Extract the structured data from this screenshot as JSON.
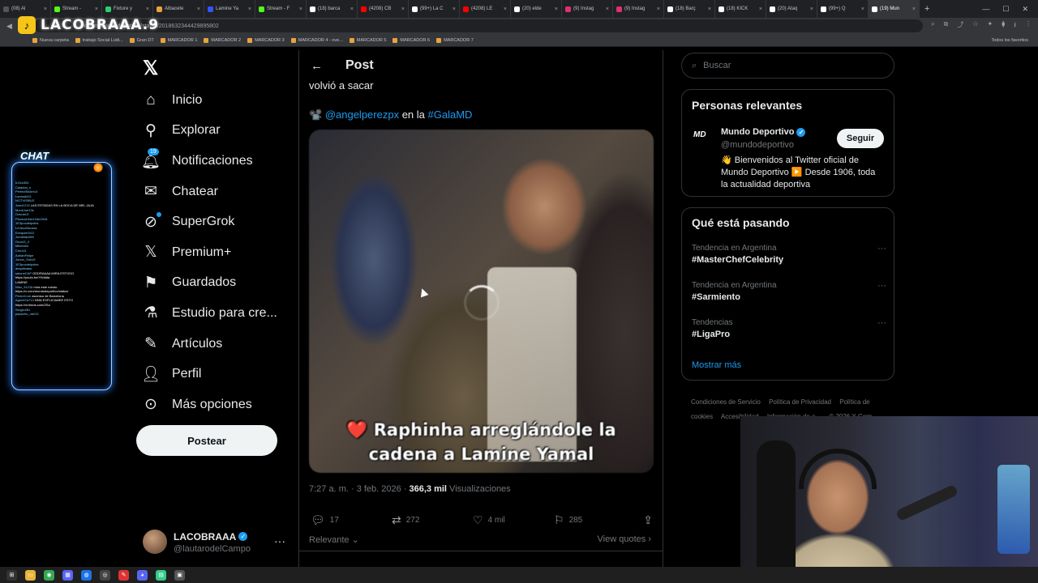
{
  "browser": {
    "tabs": [
      {
        "label": "(08) Al",
        "color": "#555"
      },
      {
        "label": "Stream - ",
        "color": "#53fc18"
      },
      {
        "label": "Fixture y",
        "color": "#2ecc71"
      },
      {
        "label": "Albacete",
        "color": "#e8a33d"
      },
      {
        "label": "Lamine Ya",
        "color": "#3355ff"
      },
      {
        "label": "Stream - F",
        "color": "#53fc18"
      },
      {
        "label": "(18) barca",
        "color": "#ffffff"
      },
      {
        "label": "(4208) CB",
        "color": "#ff0000"
      },
      {
        "label": "(99+) La C",
        "color": "#ffffff"
      },
      {
        "label": "(4208) LE",
        "color": "#ff0000"
      },
      {
        "label": "(20) elde",
        "color": "#ffffff"
      },
      {
        "label": "(9) Instag",
        "color": "#e1306c"
      },
      {
        "label": "(9) Instag",
        "color": "#e1306c"
      },
      {
        "label": "(18) Barç",
        "color": "#ffffff"
      },
      {
        "label": "(18) KICK",
        "color": "#ffffff"
      },
      {
        "label": "(20) Ataq",
        "color": "#ffffff"
      },
      {
        "label": "(99+) Q",
        "color": "#ffffff"
      },
      {
        "label": "(19) Mun",
        "color": "#ffffff",
        "active": true
      }
    ],
    "url": "x.com/mundodeportivo/status/2018632344429895802",
    "bookmarks": [
      "Nueva carpeta",
      "trabajo Social Lúdi...",
      "Gran DT",
      "MARCADOR 1",
      "MARCADOR 2",
      "MARCADOR 3",
      "MARCADOR 4 - ove...",
      "MARCADOR 5",
      "MARCADOR 6",
      "MARCADOR 7"
    ],
    "bookmarks_all": "Todos los favoritos"
  },
  "stream": {
    "channel_name": "LACOBRAAA.9",
    "chat_title": "CHAT",
    "chat_lines": [
      {
        "user": "k13ur381",
        "msg": ""
      },
      {
        "user": "Caladon_s",
        "msg": ""
      },
      {
        "user": "PerfectSlider14",
        "msg": ""
      },
      {
        "user": "Lamoski13",
        "msg": ""
      },
      {
        "user": "NOTVISIBLE",
        "msg": ""
      },
      {
        "user": "Juan1213",
        "msg": "LAS ESTADAS EN LA BOCA DE MEL JAJA"
      },
      {
        "user": "MonkJoe13s",
        "msg": ""
      },
      {
        "user": "Ozuna13",
        "msg": ""
      },
      {
        "user": "Pizarra10de12de2018",
        "msg": ""
      },
      {
        "user": "1E3pocdelpoles",
        "msg": ""
      },
      {
        "user": "LeVecoNicolas",
        "msg": ""
      },
      {
        "user": "Ezequie0412",
        "msg": ""
      },
      {
        "user": "JonathanDM",
        "msg": ""
      },
      {
        "user": "Gucci3_4",
        "msg": ""
      },
      {
        "user": "Mikeeal4",
        "msg": ""
      },
      {
        "user": "Cris141",
        "msg": ""
      },
      {
        "user": "AdrianFelipe",
        "msg": ""
      },
      {
        "user": "Jonnn_Smi19",
        "msg": ""
      },
      {
        "user": "1E3pocdelpoles",
        "msg": ""
      },
      {
        "user": "despitinator",
        "msg": ""
      },
      {
        "user": "saloneCAP",
        "msg": "ODDRAAAA MIRA ESTOOO"
      },
      {
        "user": "",
        "msg": "https://youtu.be/Y0ddda"
      },
      {
        "user": "",
        "msg": "LAMINE"
      },
      {
        "user": "Niko_91218",
        "msg": "mira este roboto"
      },
      {
        "user": "",
        "msg": "https://x.com/mundodeportivo/status/"
      },
      {
        "user": "FlexinCom",
        "msg": "ascenso de Barcelona"
      },
      {
        "user": "Agentt7a713",
        "msg": "NNN EXPLICAMEE ESTO"
      },
      {
        "user": "",
        "msg": "https://vt.tiktok.com/ZSa"
      },
      {
        "user": "Sergio281",
        "msg": ""
      },
      {
        "user": "papacho_mei13",
        "msg": ""
      }
    ]
  },
  "nav": {
    "items": [
      {
        "label": "Inicio",
        "icon": "home-icon"
      },
      {
        "label": "Explorar",
        "icon": "search-icon"
      },
      {
        "label": "Notificaciones",
        "icon": "bell-icon"
      },
      {
        "label": "Chatear",
        "icon": "mail-icon"
      },
      {
        "label": "SuperGrok",
        "icon": "grok-icon"
      },
      {
        "label": "Premium+",
        "icon": "x-icon"
      },
      {
        "label": "Guardados",
        "icon": "bookmark-icon"
      },
      {
        "label": "Estudio para cre...",
        "icon": "flask-icon"
      },
      {
        "label": "Artículos",
        "icon": "article-icon"
      },
      {
        "label": "Perfil",
        "icon": "person-icon"
      },
      {
        "label": "Más opciones",
        "icon": "more-circle-icon"
      }
    ],
    "notif_count": "19",
    "post_button": "Postear",
    "account": {
      "name": "LACOBRAAA",
      "handle": "@lautarodelCampo"
    }
  },
  "post": {
    "header_title": "Post",
    "text_line": "volvió a sacar",
    "credit_prefix": "📽️",
    "credit_user": "@angelperezpx",
    "credit_mid": "en la",
    "credit_tag": "#GalaMD",
    "caption_line1": "Raphinha arreglándole la",
    "caption_line2": "cadena a Lamine Yamal",
    "time": "7:27 a. m. · 3 feb. 2026 · ",
    "views_count": "366,3 mil",
    "views_label": " Visualizaciones",
    "replies": "17",
    "reposts": "272",
    "likes": "4 mil",
    "bookmarks": "285",
    "sort_label": "Relevante",
    "view_quotes": "View quotes"
  },
  "right": {
    "search_placeholder": "Buscar",
    "relevant_title": "Personas relevantes",
    "relevant_user": {
      "logo": "MD",
      "name": "Mundo Deportivo",
      "handle": "@mundodeportivo",
      "follow": "Seguir",
      "bio": "👋 Bienvenidos al Twitter oficial de Mundo Deportivo ▶️ Desde 1906, toda la actualidad deportiva"
    },
    "trends_title": "Qué está pasando",
    "trends": [
      {
        "context": "Tendencia en Argentina",
        "name": "#MasterChefCelebrity"
      },
      {
        "context": "Tendencia en Argentina",
        "name": "#Sarmiento"
      },
      {
        "context": "Tendencias",
        "name": "#LigaPro"
      }
    ],
    "show_more": "Mostrar más",
    "footer": [
      "Condiciones de Servicio",
      "Política de Privacidad",
      "Política de cookies",
      "Accesibilidad",
      "Información de a...",
      "© 2026 X Corp."
    ]
  }
}
